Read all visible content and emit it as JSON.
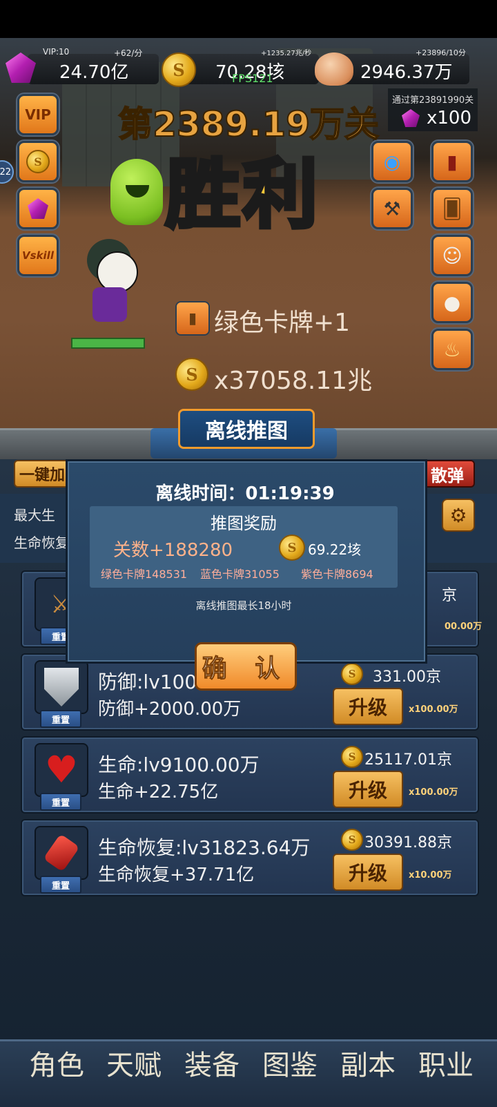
{
  "top_bar": {
    "vip": "VIP:10",
    "gems": "24.70亿",
    "gem_rate": "+62/分",
    "gold": "70.28垓",
    "gold_rate": "+1235.27兆/秒",
    "fps": "FPS121",
    "skulls": "2946.37万",
    "skull_rate": "+23896/10分"
  },
  "pass_reward": {
    "text": "通过第23891990关",
    "amount": "x100"
  },
  "left_menu": {
    "vip_label": "VIP",
    "skill_label": "Vskill",
    "partial_number": "22"
  },
  "battle": {
    "level_title": "第2389.19万关",
    "victory": "胜利",
    "drop_card": "绿色卡牌+1",
    "drop_gold": "x37058.11兆"
  },
  "side_buttons": {
    "left_partial": "一键加",
    "right_partial": "散弹"
  },
  "stats_partial": {
    "line1": "最大生",
    "line2": "生命恢复"
  },
  "dialog": {
    "title": "离线推图",
    "time_label": "离线时间：01:19:39",
    "reward_title": "推图奖励",
    "levels": "关数+188280",
    "gold": "69.22垓",
    "green_cards": "绿色卡牌148531",
    "blue_cards": "蓝色卡牌31055",
    "purple_cards": "紫色卡牌8694",
    "max_note": "离线推图最长18小时",
    "confirm": "确 认"
  },
  "upgrades": [
    {
      "name": "攻击",
      "line1": "",
      "line2": "",
      "cost": "京",
      "mult": "00.00万",
      "reset": "重置"
    },
    {
      "name": "防御",
      "line1": "防御:lv100",
      "line2": "防御+2000.00万",
      "cost": "331.00京",
      "mult": "x100.00万",
      "upgrade": "升级",
      "reset": "重置"
    },
    {
      "name": "生命",
      "line1": "生命:lv9100.00万",
      "line2": "生命+22.75亿",
      "cost": "25117.01京",
      "mult": "x100.00万",
      "upgrade": "升级",
      "reset": "重置"
    },
    {
      "name": "生命恢复",
      "line1": "生命恢复:lv31823.64万",
      "line2": "生命恢复+37.71亿",
      "cost": "30391.88京",
      "mult": "x10.00万",
      "upgrade": "升级",
      "reset": "重置"
    }
  ],
  "bottom_nav": [
    "角色",
    "天赋",
    "装备",
    "图鉴",
    "副本",
    "职业"
  ],
  "colors": {
    "accent_orange": "#f08a2a",
    "victory_gold": "#ffc93a",
    "panel_blue": "#2b4a6a",
    "reward_red": "#ffb28a",
    "card_green": "#ffae9a"
  },
  "icons": {
    "gem": "gem-icon",
    "coin": "coin-icon",
    "skull": "skull-icon",
    "settings": "gear-icon"
  }
}
